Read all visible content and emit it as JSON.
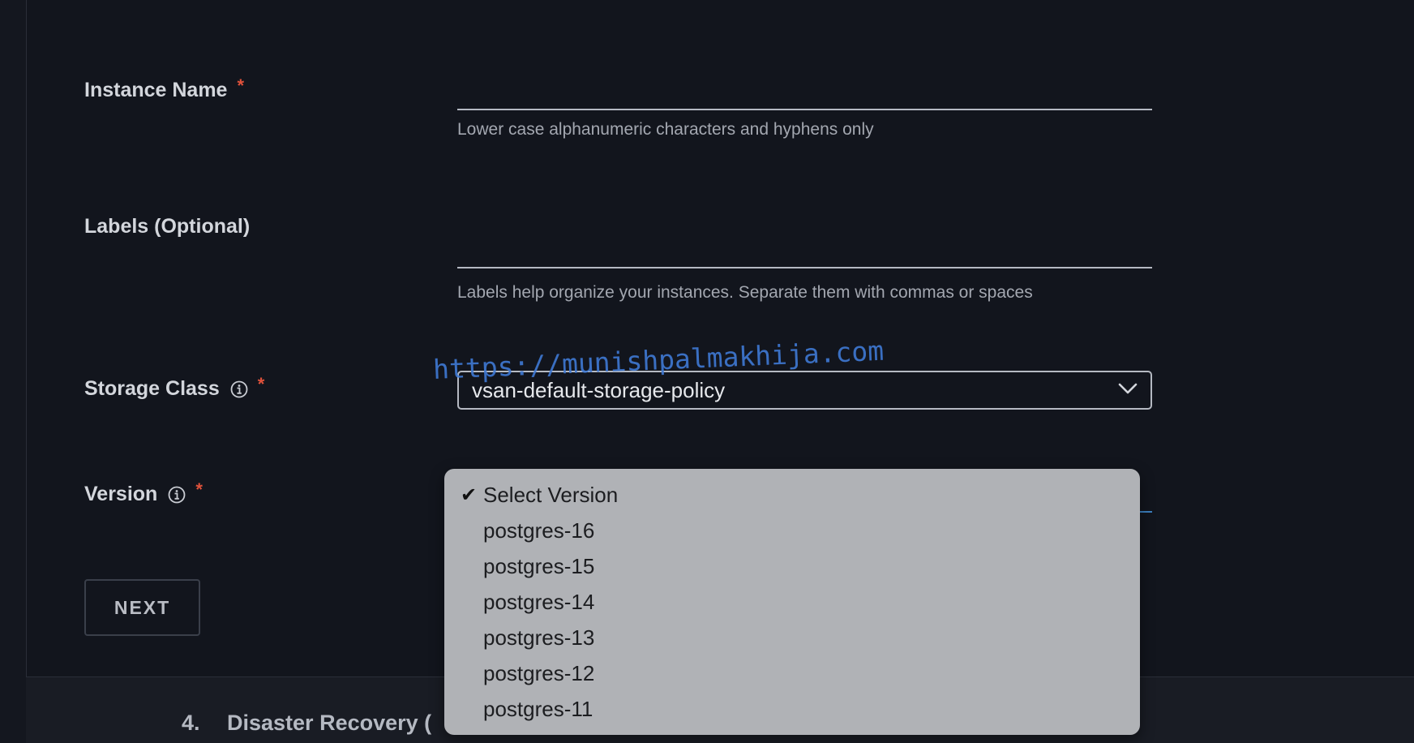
{
  "form": {
    "instance_name": {
      "label": "Instance Name",
      "required_mark": "*",
      "value": "",
      "helper": "Lower case alphanumeric characters and hyphens only"
    },
    "labels": {
      "label": "Labels (Optional)",
      "value": "",
      "helper": "Labels help organize your instances. Separate them with commas or spaces"
    },
    "storage_class": {
      "label": "Storage Class",
      "required_mark": "*",
      "icon": "info-icon",
      "selected": "vsan-default-storage-policy",
      "icon_dropdown": "chevron-down-icon"
    },
    "version": {
      "label": "Version",
      "required_mark": "*",
      "icon": "info-icon",
      "dropdown_open": true,
      "options": [
        {
          "label": "Select Version",
          "checked": true
        },
        {
          "label": "postgres-16",
          "checked": false
        },
        {
          "label": "postgres-15",
          "checked": false
        },
        {
          "label": "postgres-14",
          "checked": false
        },
        {
          "label": "postgres-13",
          "checked": false
        },
        {
          "label": "postgres-12",
          "checked": false
        },
        {
          "label": "postgres-11",
          "checked": false
        }
      ]
    }
  },
  "actions": {
    "next_label": "NEXT"
  },
  "next_step": {
    "number": "4.",
    "title": "Disaster Recovery ("
  },
  "watermark": "https://munishpalmakhija.com",
  "colors": {
    "background": "#12151d",
    "required": "#e0523b",
    "watermark": "#3f79d4",
    "dropdown_bg": "#b0b2b6"
  }
}
